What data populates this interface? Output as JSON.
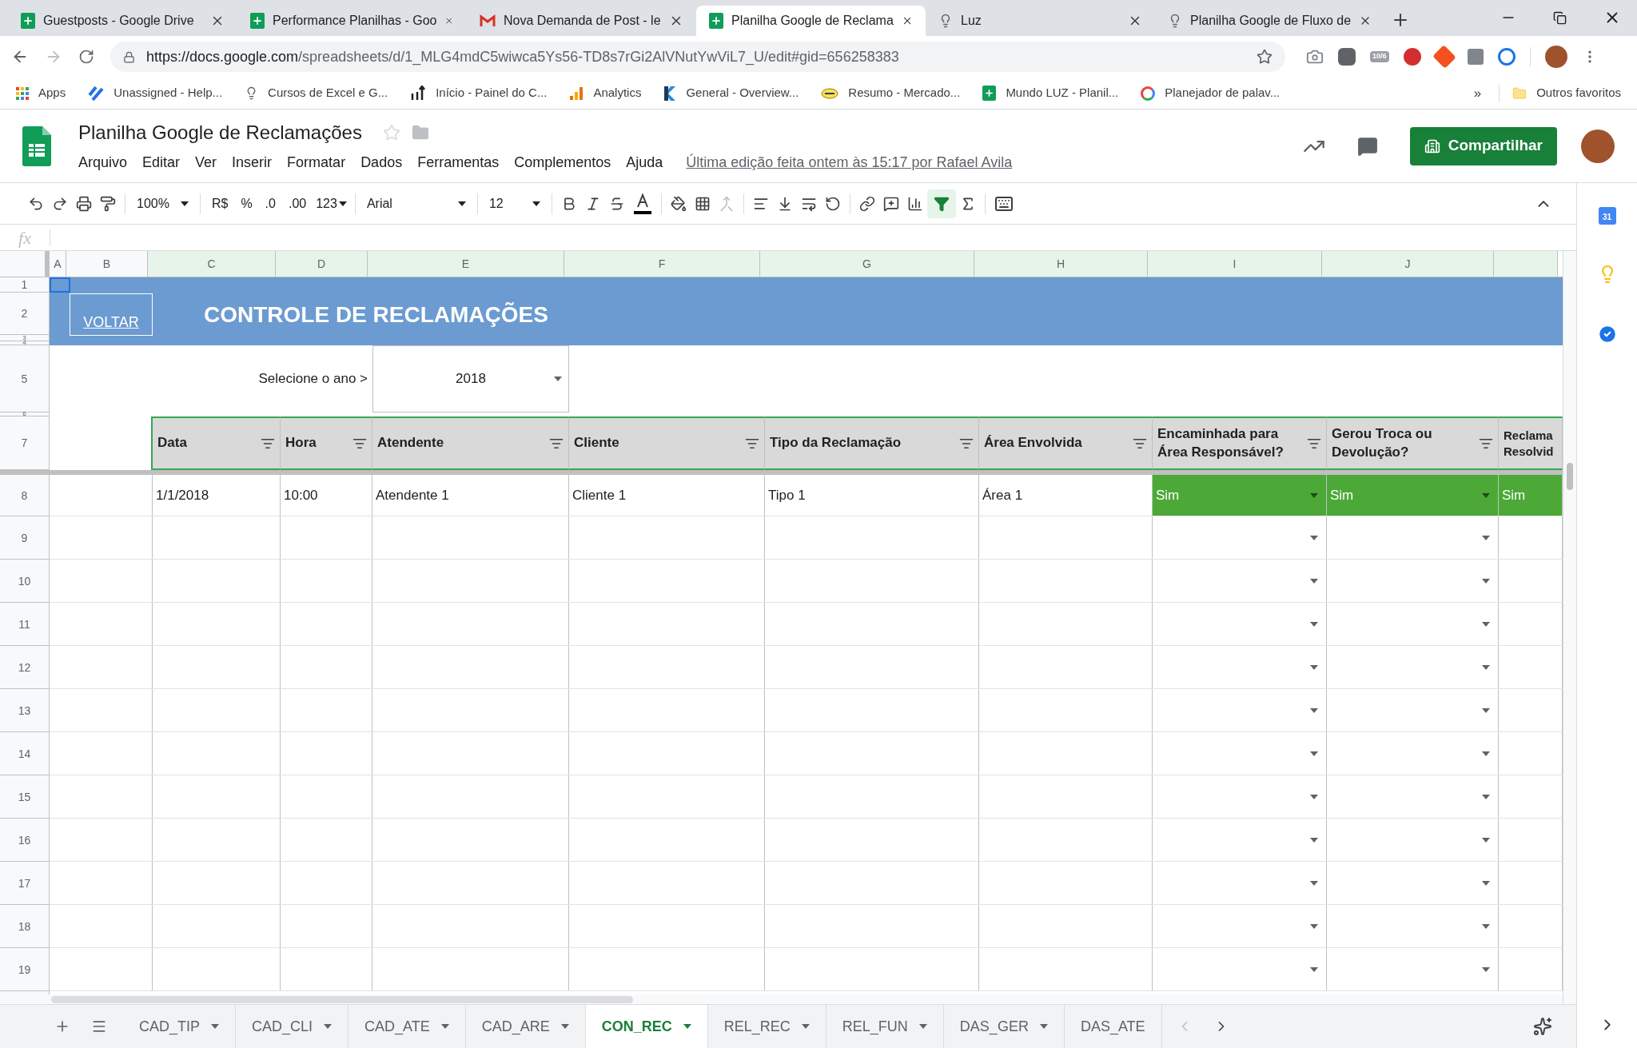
{
  "browser_tabs": [
    {
      "title": "Guestposts - Google Drive",
      "selected": false
    },
    {
      "title": "Performance Planilhas - Goo",
      "selected": false
    },
    {
      "title": "Nova Demanda de Post - le",
      "selected": false
    },
    {
      "title": "Planilha Google de Reclama",
      "selected": true
    },
    {
      "title": "Luz",
      "selected": false
    },
    {
      "title": "Planilha Google de Fluxo de",
      "selected": false
    }
  ],
  "address": {
    "host": "https://docs.google.com",
    "path": "/spreadsheets/d/1_MLG4mdC5wiwca5Ys56-TD8s7rGi2AlVNutYwViL7_U/edit#gid=656258383"
  },
  "extension_badge": "10/6",
  "bookmarks": [
    "Apps",
    "Unassigned - Help...",
    "Cursos de Excel e G...",
    "Início - Painel do C...",
    "Analytics",
    "General - Overview...",
    "Resumo - Mercado...",
    "Mundo LUZ - Planil...",
    "Planejador de palav..."
  ],
  "bookmarks_more": "»",
  "other_bookmarks": "Outros favoritos",
  "doc": {
    "title": "Planilha Google de Reclamações",
    "menu": [
      "Arquivo",
      "Editar",
      "Ver",
      "Inserir",
      "Formatar",
      "Dados",
      "Ferramentas",
      "Complementos",
      "Ajuda"
    ],
    "last_edit": "Última edição feita ontem às 15:17 por Rafael Avila",
    "share": "Compartilhar"
  },
  "toolbar": {
    "zoom": "100%",
    "currency": "R$",
    "percent": "%",
    "decrease_decimals": ".0",
    "increase_decimals": ".00",
    "number_format": "123",
    "font": "Arial",
    "font_size": "12",
    "filter_on": true
  },
  "formula_bar": {
    "fx": "fx"
  },
  "columns": [
    {
      "label": "A",
      "in_filter": false
    },
    {
      "label": "B",
      "in_filter": false
    },
    {
      "label": "C",
      "in_filter": true
    },
    {
      "label": "D",
      "in_filter": true
    },
    {
      "label": "E",
      "in_filter": true
    },
    {
      "label": "F",
      "in_filter": true
    },
    {
      "label": "G",
      "in_filter": true
    },
    {
      "label": "H",
      "in_filter": true
    },
    {
      "label": "I",
      "in_filter": true
    },
    {
      "label": "J",
      "in_filter": true
    }
  ],
  "row_numbers": [
    "1",
    "2",
    "3",
    "4",
    "5",
    "6",
    "7",
    "8",
    "9",
    "10",
    "11",
    "12",
    "13",
    "14",
    "15",
    "16",
    "17",
    "18",
    "19"
  ],
  "banner": {
    "link": "VOLTAR",
    "title": "CONTROLE DE RECLAMAÇÕES"
  },
  "year_selector": {
    "label": "Selecione o ano >",
    "value": "2018"
  },
  "table": {
    "columns": [
      {
        "label": "Data",
        "kind": "text"
      },
      {
        "label": "Hora",
        "kind": "text"
      },
      {
        "label": "Atendente",
        "kind": "text"
      },
      {
        "label": "Cliente",
        "kind": "text"
      },
      {
        "label": "Tipo da Reclamação",
        "kind": "text"
      },
      {
        "label": "Área Envolvida",
        "kind": "text"
      },
      {
        "label": "Encaminhada para Área Responsável?",
        "kind": "dropdown"
      },
      {
        "label": "Gerou Troca ou Devolução?",
        "kind": "dropdown"
      },
      {
        "label": "Reclama Resolvid",
        "kind": "status"
      }
    ],
    "rows": [
      [
        "1/1/2018",
        "10:00",
        "Atendente 1",
        "Cliente 1",
        "Tipo 1",
        "Área 1",
        "Sim",
        "Sim",
        "Sim"
      ]
    ]
  },
  "sheet_tabs": [
    {
      "label": "CAD_TIP",
      "selected": false
    },
    {
      "label": "CAD_CLI",
      "selected": false
    },
    {
      "label": "CAD_ATE",
      "selected": false
    },
    {
      "label": "CAD_ARE",
      "selected": false
    },
    {
      "label": "CON_REC",
      "selected": true
    },
    {
      "label": "REL_REC",
      "selected": false
    },
    {
      "label": "REL_FUN",
      "selected": false
    },
    {
      "label": "DAS_GER",
      "selected": false
    },
    {
      "label": "DAS_ATE",
      "selected": false
    }
  ],
  "side_panel": {
    "calendar_day": "31"
  }
}
